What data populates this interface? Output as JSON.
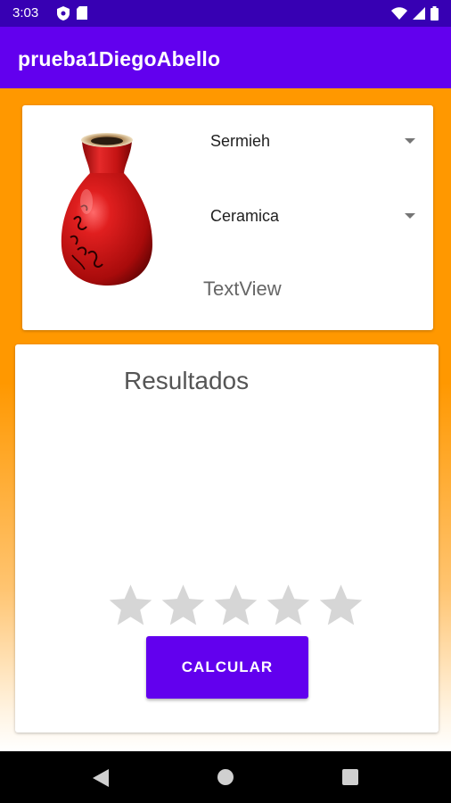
{
  "status_bar": {
    "time": "3:03",
    "left_icons": [
      "shield-icon",
      "sd-card-icon"
    ],
    "right_icons": [
      "wifi-icon",
      "signal-icon",
      "battery-icon"
    ]
  },
  "app_bar": {
    "title": "prueba1DiegoAbello"
  },
  "top_card": {
    "image": "red-vase-image",
    "spinner_1": {
      "selected": "Sermieh"
    },
    "spinner_2": {
      "selected": "Ceramica"
    },
    "textview": "TextView"
  },
  "results_card": {
    "title": "Resultados",
    "rating": {
      "value": 0,
      "max": 5
    },
    "calculate_button": "CALCULAR"
  },
  "nav_bar": {
    "icons": [
      "back-icon",
      "home-icon",
      "recents-icon"
    ]
  },
  "colors": {
    "status_bar": "#3700B3",
    "primary": "#6200EE",
    "background": "#FF9800",
    "star_empty": "#D6D6D6"
  }
}
